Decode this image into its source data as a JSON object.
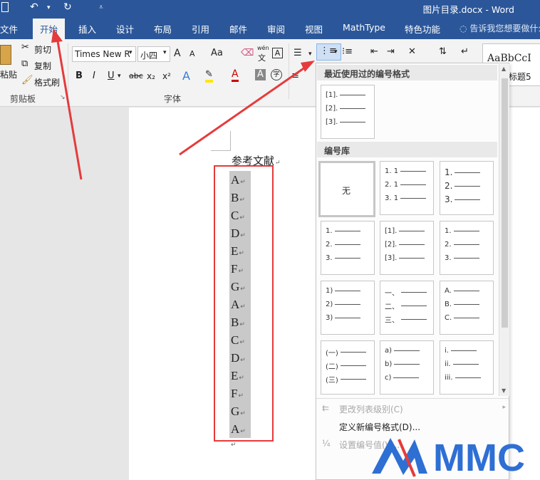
{
  "window": {
    "title": "图片目录.docx - Word"
  },
  "tabs": [
    {
      "label": "文件"
    },
    {
      "label": "开始"
    },
    {
      "label": "插入"
    },
    {
      "label": "设计"
    },
    {
      "label": "布局"
    },
    {
      "label": "引用"
    },
    {
      "label": "邮件"
    },
    {
      "label": "审阅"
    },
    {
      "label": "视图"
    },
    {
      "label": "MathType"
    },
    {
      "label": "特色功能"
    }
  ],
  "tellme": "告诉我您想要做什么",
  "ribbon": {
    "paste": "粘贴",
    "cut": "剪切",
    "copy": "复制",
    "format_painter": "格式刷",
    "clipboard_group": "剪贴板",
    "font_name": "Times New R",
    "font_size": "小四",
    "font_group": "字体",
    "wen": "wén",
    "wen_char": "文",
    "bold": "B",
    "italic": "I",
    "underline": "U",
    "strike": "abc",
    "subscript": "x₂",
    "superscript": "x²",
    "grow": "A",
    "shrink": "A",
    "case": "Aa",
    "style_preview": "AaBbCcI",
    "style_name": "标题5"
  },
  "document": {
    "heading": "参考文献",
    "items": [
      "A",
      "B",
      "C",
      "D",
      "E",
      "F",
      "G",
      "A",
      "B",
      "C",
      "D",
      "E",
      "F",
      "G",
      "A"
    ]
  },
  "numbering_menu": {
    "recent_header": "最近使用过的编号格式",
    "library_header": "编号库",
    "recent": [
      [
        "[1].",
        "[2].",
        "[3]."
      ]
    ],
    "library": [
      [
        "无"
      ],
      [
        "1. 1",
        "2. 1",
        "3. 1"
      ],
      [
        "1.",
        "2.",
        "3."
      ],
      [
        "1.",
        "2.",
        "3."
      ],
      [
        "[1].",
        "[2].",
        "[3]."
      ],
      [
        "1.",
        "2.",
        "3."
      ],
      [
        "1)",
        "2)",
        "3)"
      ],
      [
        "一、",
        "二、",
        "三、"
      ],
      [
        "A.",
        "B.",
        "C."
      ],
      [
        "(一)",
        "(二)",
        "(三)"
      ],
      [
        "a)",
        "b)",
        "c)"
      ],
      [
        "i.",
        "ii.",
        "iii."
      ]
    ],
    "change_level": "更改列表级别(C)",
    "define_new": "定义新编号格式(D)...",
    "set_value": "设置编号值(V)..."
  },
  "watermark": "MMC",
  "colors": {
    "accent": "#2b579a",
    "annotation": "#e53b3b",
    "watermark": "#2e6fd4"
  }
}
